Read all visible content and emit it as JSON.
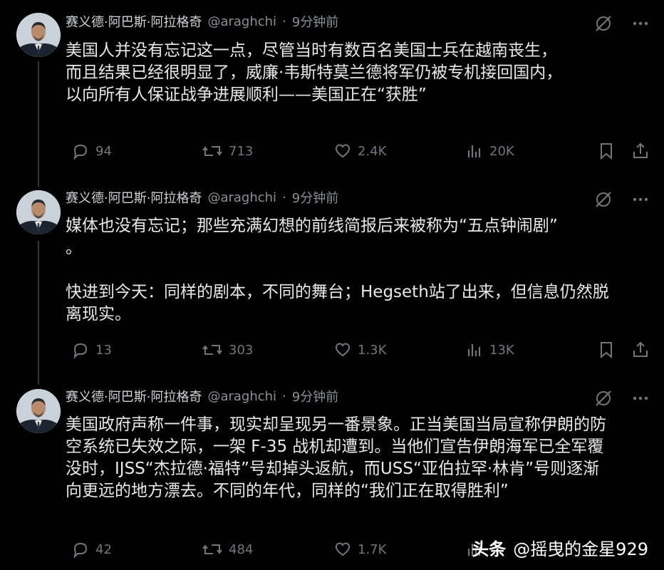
{
  "author": {
    "name": "赛义德·阿巴斯·阿拉格奇",
    "handle": "@araghchi",
    "dot": "·",
    "time": "9分钟前"
  },
  "icons": {
    "grok": "grok-icon",
    "more": "more-icon",
    "reply": "reply-icon",
    "repost": "repost-icon",
    "like": "like-icon",
    "views": "views-icon",
    "bookmark": "bookmark-icon",
    "share": "share-icon"
  },
  "colors": {
    "background": "#000000",
    "text": "#e7e9ea",
    "muted": "#71767b",
    "thread_line": "#333639"
  },
  "tweets": [
    {
      "text": "美国人并没有忘记这一点，尽管当时有数百名美国士兵在越南丧生，\n而且结果已经很明显了，威廉·韦斯特莫兰德将军仍被专机接回国内，\n以向所有人保证战争进展顺利——美国正在“获胜”",
      "replies": "94",
      "reposts": "713",
      "likes": "2.4K",
      "views": "20K"
    },
    {
      "text": "媒体也没有忘记；那些充满幻想的前线简报后来被称为“五点钟闹剧”\n。\n\n快进到今天：同样的剧本，不同的舞台；Hegseth站了出来，但信息仍然脱\n离现实。",
      "replies": "13",
      "reposts": "303",
      "likes": "1.3K",
      "views": "13K"
    },
    {
      "text": "美国政府声称一件事，现实却呈现另一番景象。正当美国当局宣称伊朗的防\n空系统已失效之际，一架 F-35 战机却遭到。当他们宣告伊朗海军已全军覆\n没时，IJSS“杰拉德·福特”号却掉头返航，而USS“亚伯拉罕·林肯”号则逐渐\n向更远的地方漂去。不同的年代，同样的“我们正在取得胜利”",
      "replies": "42",
      "reposts": "484",
      "likes": "1.7K",
      "views": ""
    }
  ],
  "watermark": {
    "brand": "头条",
    "account": "@摇曳的金星929"
  }
}
